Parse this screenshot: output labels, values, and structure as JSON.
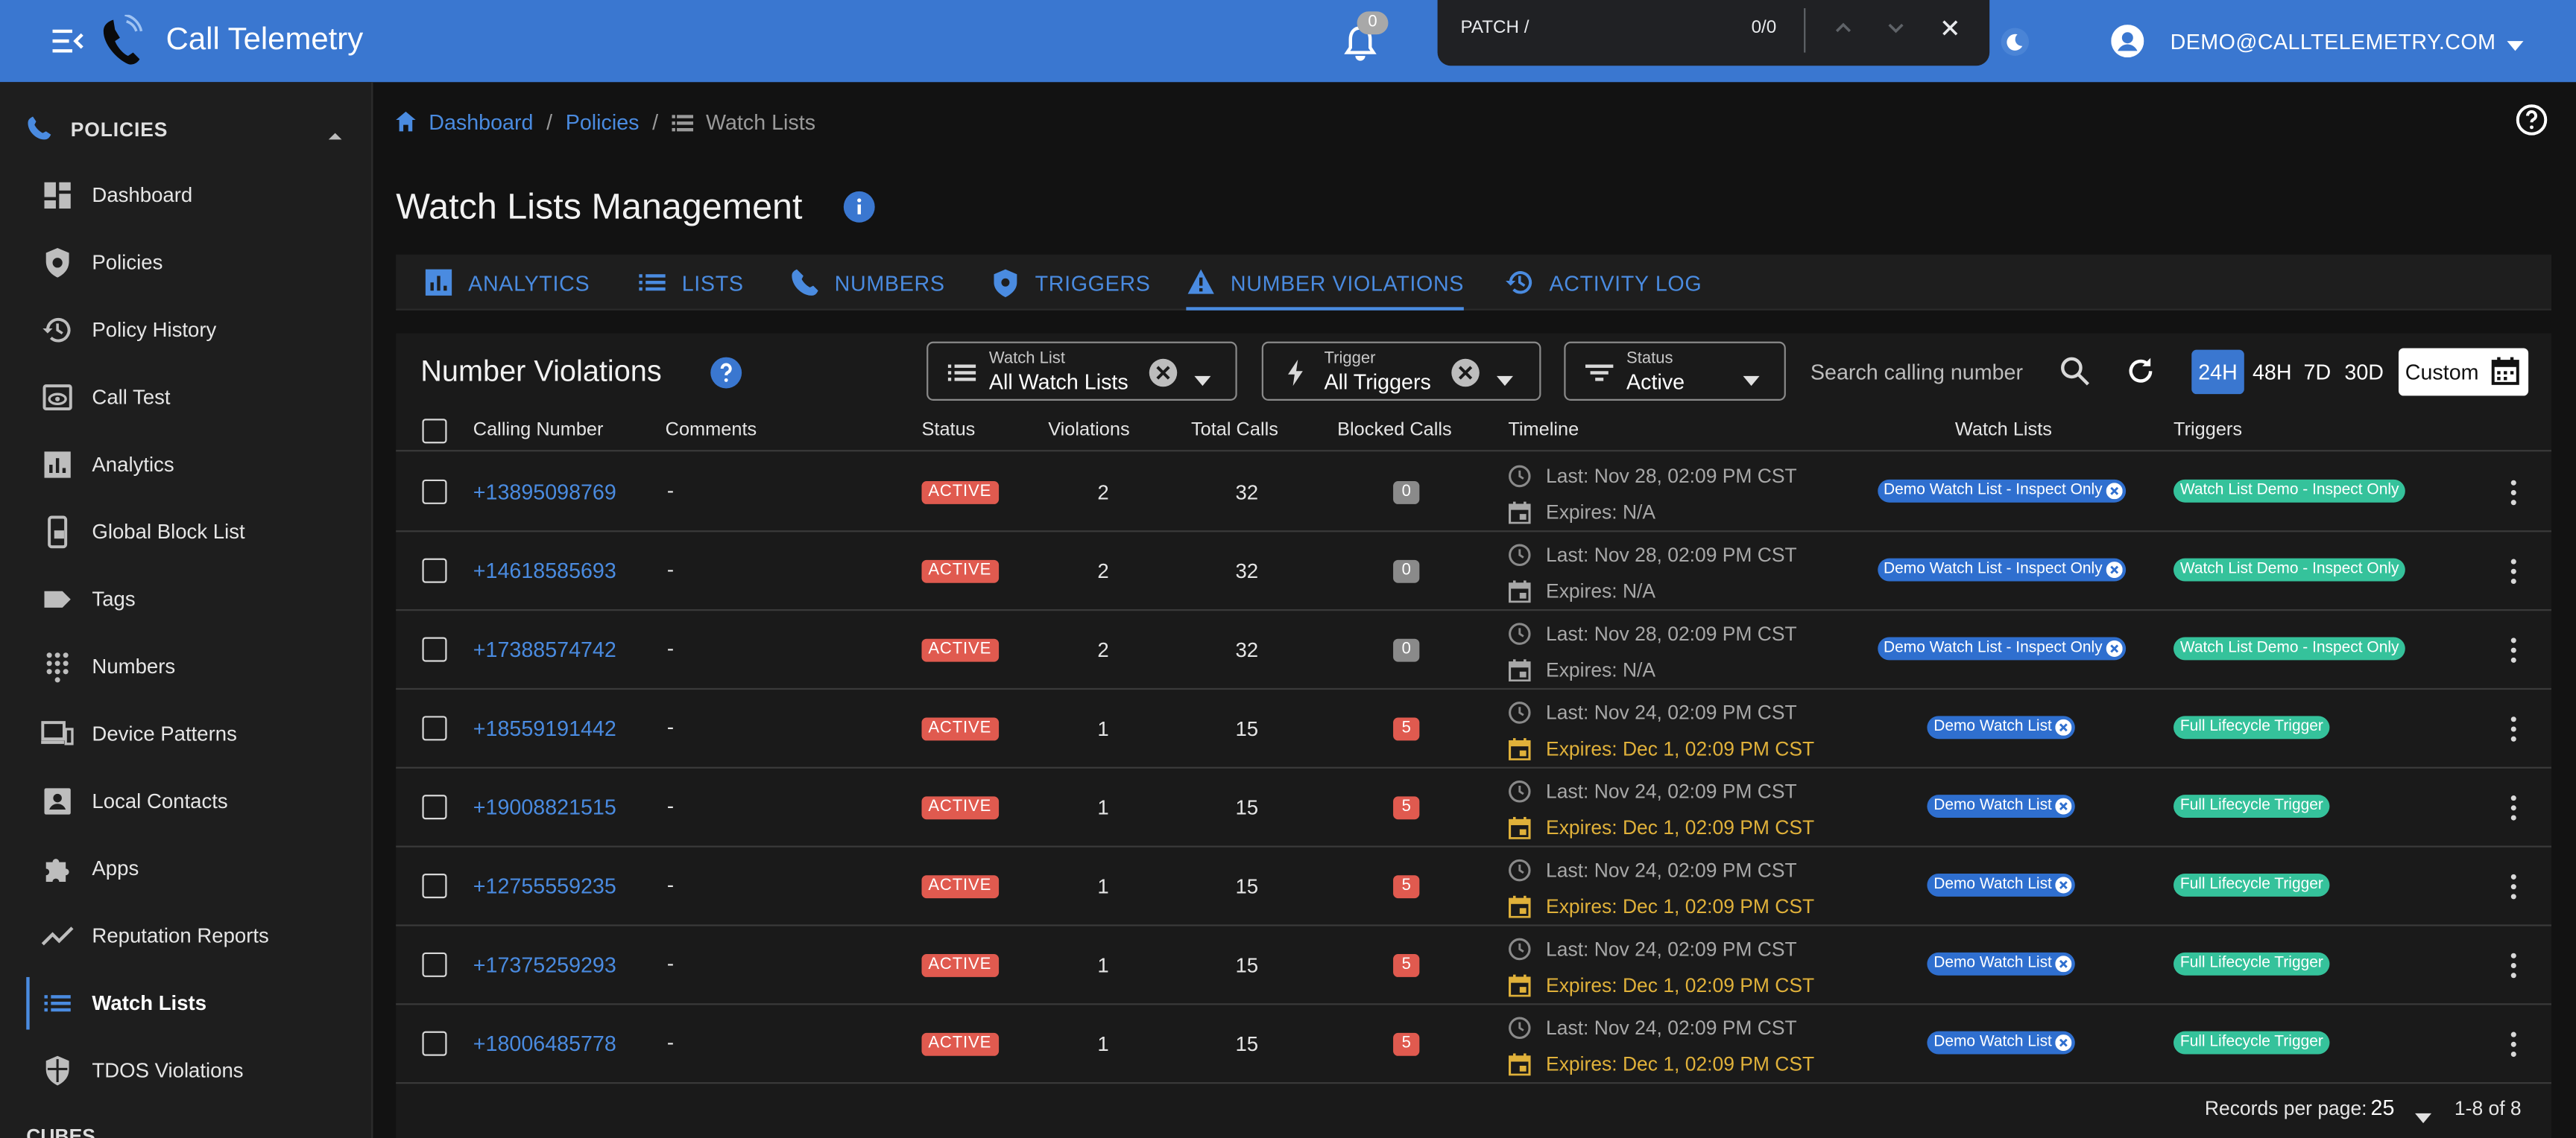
{
  "app": {
    "title": "Call Telemetry",
    "notifications_count": "0",
    "user_email": "DEMO@CALLTELEMETRY.COM"
  },
  "find_bar": {
    "query": "PATCH /",
    "count": "0/0"
  },
  "sidebar": {
    "section_label": "POLICIES",
    "items": [
      {
        "label": "Dashboard",
        "icon": "dashboard-icon"
      },
      {
        "label": "Policies",
        "icon": "shield-gear-icon"
      },
      {
        "label": "Policy History",
        "icon": "history-icon"
      },
      {
        "label": "Call Test",
        "icon": "preview-eye-icon"
      },
      {
        "label": "Analytics",
        "icon": "analytics-chart-icon"
      },
      {
        "label": "Global Block List",
        "icon": "phonelink-lock-icon"
      },
      {
        "label": "Tags",
        "icon": "label-tag-icon"
      },
      {
        "label": "Numbers",
        "icon": "dialpad-icon"
      },
      {
        "label": "Device Patterns",
        "icon": "devices-icon"
      },
      {
        "label": "Local Contacts",
        "icon": "contacts-icon"
      },
      {
        "label": "Apps",
        "icon": "extension-puzzle-icon"
      },
      {
        "label": "Reputation Reports",
        "icon": "trending-line-icon"
      },
      {
        "label": "Watch Lists",
        "icon": "list-icon",
        "active": true
      },
      {
        "label": "TDOS Violations",
        "icon": "security-shield-icon"
      }
    ],
    "next_section_partial": "CUBES"
  },
  "breadcrumb": {
    "home": "Dashboard",
    "parent": "Policies",
    "current": "Watch Lists"
  },
  "page": {
    "title": "Watch Lists Management"
  },
  "tabs": [
    {
      "label": "ANALYTICS",
      "icon": "analytics-icon"
    },
    {
      "label": "LISTS",
      "icon": "list-icon"
    },
    {
      "label": "NUMBERS",
      "icon": "phone-icon"
    },
    {
      "label": "TRIGGERS",
      "icon": "shield-icon"
    },
    {
      "label": "NUMBER VIOLATIONS",
      "icon": "warning-icon",
      "active": true
    },
    {
      "label": "ACTIVITY LOG",
      "icon": "history-icon"
    }
  ],
  "panel": {
    "title": "Number Violations",
    "filters": {
      "watch_list": {
        "label": "Watch List",
        "value": "All Watch Lists"
      },
      "trigger": {
        "label": "Trigger",
        "value": "All Triggers"
      },
      "status": {
        "label": "Status",
        "value": "Active"
      }
    },
    "search_placeholder": "Search calling number",
    "ranges": [
      "24H",
      "48H",
      "7D",
      "30D"
    ],
    "active_range": "24H",
    "custom_label": "Custom"
  },
  "table": {
    "columns": [
      "Calling Number",
      "Comments",
      "Status",
      "Violations",
      "Total Calls",
      "Blocked Calls",
      "Timeline",
      "Watch Lists",
      "Triggers"
    ],
    "rows": [
      {
        "number": "+13895098769",
        "comments": "-",
        "status": "ACTIVE",
        "violations": "2",
        "total_calls": "32",
        "blocked_calls": "0",
        "last": "Last: Nov 28, 02:09 PM CST",
        "expires": "Expires: N/A",
        "watch_list": "Demo Watch List - Inspect Only",
        "trigger": "Watch List Demo - Inspect Only"
      },
      {
        "number": "+14618585693",
        "comments": "-",
        "status": "ACTIVE",
        "violations": "2",
        "total_calls": "32",
        "blocked_calls": "0",
        "last": "Last: Nov 28, 02:09 PM CST",
        "expires": "Expires: N/A",
        "watch_list": "Demo Watch List - Inspect Only",
        "trigger": "Watch List Demo - Inspect Only"
      },
      {
        "number": "+17388574742",
        "comments": "-",
        "status": "ACTIVE",
        "violations": "2",
        "total_calls": "32",
        "blocked_calls": "0",
        "last": "Last: Nov 28, 02:09 PM CST",
        "expires": "Expires: N/A",
        "watch_list": "Demo Watch List - Inspect Only",
        "trigger": "Watch List Demo - Inspect Only"
      },
      {
        "number": "+18559191442",
        "comments": "-",
        "status": "ACTIVE",
        "violations": "1",
        "total_calls": "15",
        "blocked_calls": "5",
        "last": "Last: Nov 24, 02:09 PM CST",
        "expires": "Expires: Dec 1, 02:09 PM CST",
        "watch_list": "Demo Watch List",
        "trigger": "Full Lifecycle Trigger"
      },
      {
        "number": "+19008821515",
        "comments": "-",
        "status": "ACTIVE",
        "violations": "1",
        "total_calls": "15",
        "blocked_calls": "5",
        "last": "Last: Nov 24, 02:09 PM CST",
        "expires": "Expires: Dec 1, 02:09 PM CST",
        "watch_list": "Demo Watch List",
        "trigger": "Full Lifecycle Trigger"
      },
      {
        "number": "+12755559235",
        "comments": "-",
        "status": "ACTIVE",
        "violations": "1",
        "total_calls": "15",
        "blocked_calls": "5",
        "last": "Last: Nov 24, 02:09 PM CST",
        "expires": "Expires: Dec 1, 02:09 PM CST",
        "watch_list": "Demo Watch List",
        "trigger": "Full Lifecycle Trigger"
      },
      {
        "number": "+17375259293",
        "comments": "-",
        "status": "ACTIVE",
        "violations": "1",
        "total_calls": "15",
        "blocked_calls": "5",
        "last": "Last: Nov 24, 02:09 PM CST",
        "expires": "Expires: Dec 1, 02:09 PM CST",
        "watch_list": "Demo Watch List",
        "trigger": "Full Lifecycle Trigger"
      },
      {
        "number": "+18006485778",
        "comments": "-",
        "status": "ACTIVE",
        "violations": "1",
        "total_calls": "15",
        "blocked_calls": "5",
        "last": "Last: Nov 24, 02:09 PM CST",
        "expires": "Expires: Dec 1, 02:09 PM CST",
        "watch_list": "Demo Watch List",
        "trigger": "Full Lifecycle Trigger"
      }
    ]
  },
  "pagination": {
    "records_per_page_label": "Records per page:",
    "records_per_page": "25",
    "range": "1-8 of 8"
  },
  "colors": {
    "brand": "#3a77d0",
    "link": "#4a8be0",
    "active_status": "#e05a4f",
    "blocked_zero": "#8a8a8a",
    "blocked_nonzero": "#e05a4f",
    "expiry_warning": "#e0b13a",
    "trigger_chip": "#35c29b",
    "watchlist_chip": "#2f6fcf"
  }
}
